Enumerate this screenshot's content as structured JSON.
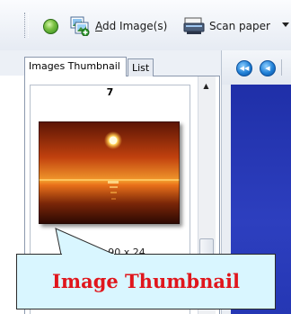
{
  "toolbar": {
    "add_image_label_prefix": "",
    "add_image_accel": "A",
    "add_image_label_rest": "dd Image(s)",
    "scan_paper_label": "Scan paper"
  },
  "tabs": [
    {
      "label": "Images Thumbnail",
      "active": true
    },
    {
      "label": "List",
      "active": false
    }
  ],
  "thumbnail": {
    "page_number": "7",
    "dimensions_text": "90 x 24"
  },
  "callout": {
    "text": "Image Thumbnail",
    "text_color": "#e0161c",
    "background": "#d9f6ff"
  },
  "icons": {
    "globe": "globe-icon",
    "add_image": "add-image-icon",
    "scan_paper": "scanner-icon",
    "first_page": "first-page-icon",
    "prev_page": "previous-page-icon"
  },
  "colors": {
    "viewer_background": "#2537b4",
    "toolbar": "#e6ebf3"
  }
}
